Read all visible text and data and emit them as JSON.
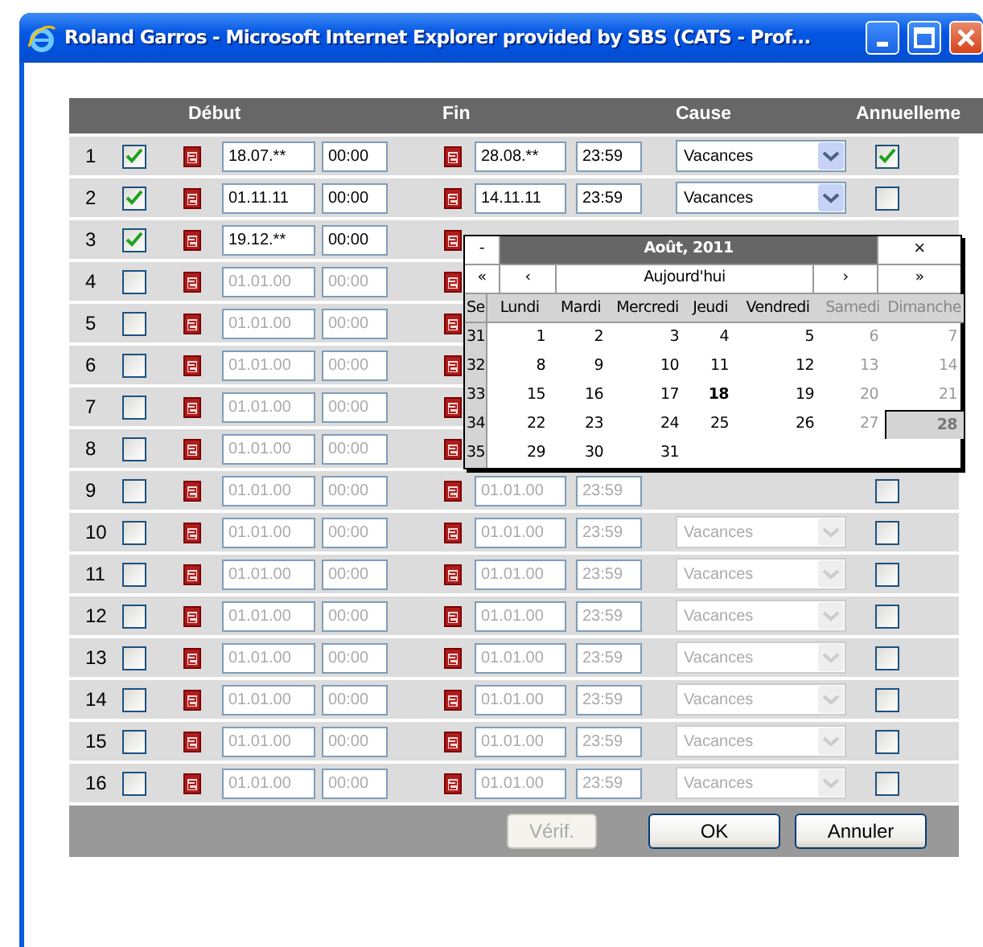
{
  "window": {
    "title": "Roland Garros - Microsoft Internet Explorer provided by SBS (CATS - Prof..."
  },
  "columns": [
    "Début",
    "Fin",
    "Cause",
    "Annuelleme"
  ],
  "rows": [
    {
      "number": "1",
      "active": true,
      "start_date": "18.07.**",
      "start_time": "00:00",
      "end_date": "28.08.**",
      "end_time": "23:59",
      "cause": "Vacances",
      "annual": true,
      "disabled": false
    },
    {
      "number": "2",
      "active": true,
      "start_date": "01.11.11",
      "start_time": "00:00",
      "end_date": "14.11.11",
      "end_time": "23:59",
      "cause": "Vacances",
      "annual": false,
      "disabled": false
    },
    {
      "number": "3",
      "active": true,
      "start_date": "19.12.**",
      "start_time": "00:00",
      "disabled": false
    },
    {
      "number": "4",
      "active": false,
      "start_date": "01.01.00",
      "start_time": "00:00",
      "disabled": true
    },
    {
      "number": "5",
      "active": false,
      "start_date": "01.01.00",
      "start_time": "00:00",
      "disabled": true
    },
    {
      "number": "6",
      "active": false,
      "start_date": "01.01.00",
      "start_time": "00:00",
      "disabled": true
    },
    {
      "number": "7",
      "active": false,
      "start_date": "01.01.00",
      "start_time": "00:00",
      "disabled": true
    },
    {
      "number": "8",
      "active": false,
      "start_date": "01.01.00",
      "start_time": "00:00",
      "disabled": true
    },
    {
      "number": "9",
      "active": false,
      "start_date": "01.01.00",
      "start_time": "00:00",
      "end_date": "01.01.00",
      "end_time": "23:59",
      "annual": false,
      "disabled": true
    },
    {
      "number": "10",
      "active": false,
      "start_date": "01.01.00",
      "start_time": "00:00",
      "end_date": "01.01.00",
      "end_time": "23:59",
      "cause": "Vacances",
      "annual": false,
      "disabled": true
    },
    {
      "number": "11",
      "active": false,
      "start_date": "01.01.00",
      "start_time": "00:00",
      "end_date": "01.01.00",
      "end_time": "23:59",
      "cause": "Vacances",
      "annual": false,
      "disabled": true
    },
    {
      "number": "12",
      "active": false,
      "start_date": "01.01.00",
      "start_time": "00:00",
      "end_date": "01.01.00",
      "end_time": "23:59",
      "cause": "Vacances",
      "annual": false,
      "disabled": true
    },
    {
      "number": "13",
      "active": false,
      "start_date": "01.01.00",
      "start_time": "00:00",
      "end_date": "01.01.00",
      "end_time": "23:59",
      "cause": "Vacances",
      "annual": false,
      "disabled": true
    },
    {
      "number": "14",
      "active": false,
      "start_date": "01.01.00",
      "start_time": "00:00",
      "end_date": "01.01.00",
      "end_time": "23:59",
      "cause": "Vacances",
      "annual": false,
      "disabled": true
    },
    {
      "number": "15",
      "active": false,
      "start_date": "01.01.00",
      "start_time": "00:00",
      "end_date": "01.01.00",
      "end_time": "23:59",
      "cause": "Vacances",
      "annual": false,
      "disabled": true
    },
    {
      "number": "16",
      "active": false,
      "start_date": "01.01.00",
      "start_time": "00:00",
      "end_date": "01.01.00",
      "end_time": "23:59",
      "cause": "Vacances",
      "annual": false,
      "disabled": true
    }
  ],
  "buttons": [
    {
      "label": "Vérif.",
      "disabled": true
    },
    {
      "label": "OK",
      "disabled": false
    },
    {
      "label": "Annuler",
      "disabled": false
    }
  ],
  "calendar": {
    "minimize": "-",
    "title": "Août, 2011",
    "close": "×",
    "nav": [
      "«",
      "‹",
      "Aujourd'hui",
      "›",
      "»"
    ],
    "week_label": "Se",
    "weekdays": [
      {
        "label": "Lundi",
        "weekend": false
      },
      {
        "label": "Mardi",
        "weekend": false
      },
      {
        "label": "Mercredi",
        "weekend": false
      },
      {
        "label": "Jeudi",
        "weekend": false
      },
      {
        "label": "Vendredi",
        "weekend": false
      },
      {
        "label": "Samedi",
        "weekend": true
      },
      {
        "label": "Dimanche",
        "weekend": true
      }
    ],
    "weeks": [
      {
        "number": "31",
        "days": [
          {
            "day": "1",
            "today": false,
            "selected": false
          },
          {
            "day": "2",
            "today": false,
            "selected": false
          },
          {
            "day": "3",
            "today": false,
            "selected": false
          },
          {
            "day": "4",
            "today": false,
            "selected": false
          },
          {
            "day": "5",
            "today": false,
            "selected": false
          },
          {
            "day": "6",
            "today": false,
            "selected": false
          },
          {
            "day": "7",
            "today": false,
            "selected": false
          }
        ]
      },
      {
        "number": "32",
        "days": [
          {
            "day": "8",
            "today": false,
            "selected": false
          },
          {
            "day": "9",
            "today": false,
            "selected": false
          },
          {
            "day": "10",
            "today": false,
            "selected": false
          },
          {
            "day": "11",
            "today": false,
            "selected": false
          },
          {
            "day": "12",
            "today": false,
            "selected": false
          },
          {
            "day": "13",
            "today": false,
            "selected": false
          },
          {
            "day": "14",
            "today": false,
            "selected": false
          }
        ]
      },
      {
        "number": "33",
        "days": [
          {
            "day": "15",
            "today": false,
            "selected": false
          },
          {
            "day": "16",
            "today": false,
            "selected": false
          },
          {
            "day": "17",
            "today": false,
            "selected": false
          },
          {
            "day": "18",
            "today": true,
            "selected": false
          },
          {
            "day": "19",
            "today": false,
            "selected": false
          },
          {
            "day": "20",
            "today": false,
            "selected": false
          },
          {
            "day": "21",
            "today": false,
            "selected": false
          }
        ]
      },
      {
        "number": "34",
        "days": [
          {
            "day": "22",
            "today": false,
            "selected": false
          },
          {
            "day": "23",
            "today": false,
            "selected": false
          },
          {
            "day": "24",
            "today": false,
            "selected": false
          },
          {
            "day": "25",
            "today": false,
            "selected": false
          },
          {
            "day": "26",
            "today": false,
            "selected": false
          },
          {
            "day": "27",
            "today": false,
            "selected": false
          },
          {
            "day": "28",
            "today": false,
            "selected": true
          }
        ]
      },
      {
        "number": "35",
        "days": [
          {
            "day": "29",
            "today": false,
            "selected": false
          },
          {
            "day": "30",
            "today": false,
            "selected": false
          },
          {
            "day": "31",
            "today": false,
            "selected": false
          }
        ]
      }
    ]
  }
}
